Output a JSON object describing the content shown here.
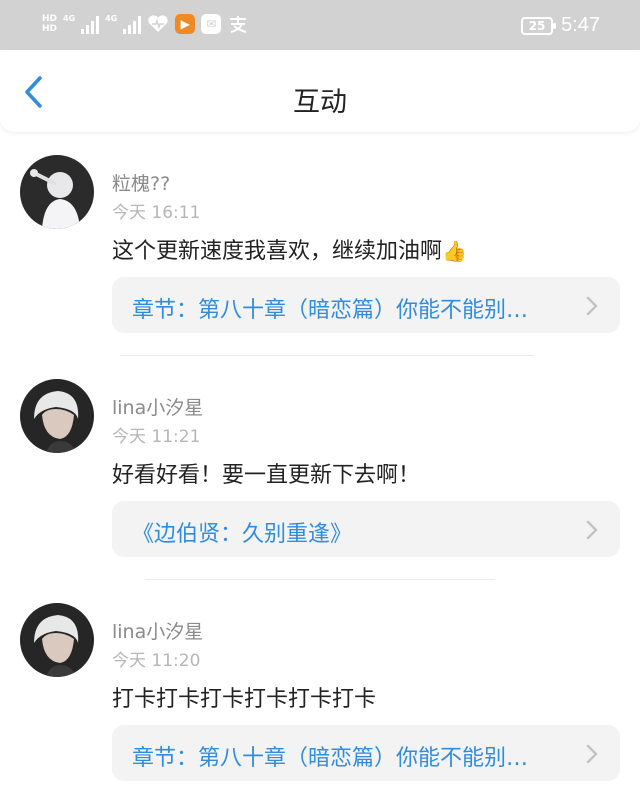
{
  "status_bar": {
    "network_labels": [
      "HD",
      "4G",
      "4G"
    ],
    "battery": "25",
    "time": "5:47"
  },
  "header": {
    "title": "互动",
    "back_icon": "chevron-left-icon"
  },
  "feed": [
    {
      "user": "粒槐??",
      "time": "今天 16:11",
      "comment": "这个更新速度我喜欢，继续加油啊",
      "emoji": "👍",
      "link": "章节：第八十章（暗恋篇）你能不能别…"
    },
    {
      "user": "lina小汐星",
      "time": "今天 11:21",
      "comment": "好看好看！要一直更新下去啊！",
      "emoji": "",
      "link": "《边伯贤：久别重逢》"
    },
    {
      "user": "lina小汐星",
      "time": "今天 11:20",
      "comment": "打卡打卡打卡打卡打卡打卡",
      "emoji": "",
      "link": "章节：第八十章（暗恋篇）你能不能别…"
    }
  ],
  "colors": {
    "status_bar_bg": "#d2d2d2",
    "accent_blue": "#2f8cde",
    "card_bg": "#f3f3f3",
    "meta_gray": "#8a8a8a"
  }
}
